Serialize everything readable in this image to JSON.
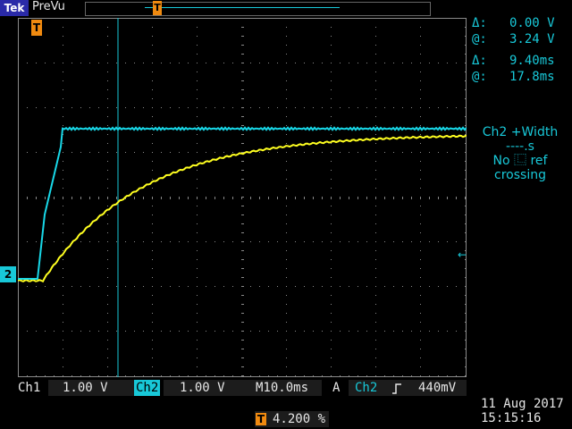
{
  "top": {
    "logo": "Tek",
    "acq_state": "PreVu",
    "trigger_marker": "T"
  },
  "screen": {
    "grid": true,
    "ch2_label": "2",
    "trigger_level_marker": "←"
  },
  "cursors": {
    "v_delta_sym": "Δ:",
    "v_delta": "0.00 V",
    "v_at_sym": "@:",
    "v_at": "3.24 V",
    "t_delta_sym": "Δ:",
    "t_delta": "9.40ms",
    "t_at_sym": "@:",
    "t_at": "17.8ms"
  },
  "measurement": {
    "line1": "Ch2 +Width",
    "line2": "----.s",
    "line3": "No ⿺ ref",
    "line4": "crossing"
  },
  "bottom": {
    "ch1_label": "Ch1",
    "ch1_scale": "1.00 V",
    "ch2_label": "Ch2",
    "ch2_scale": "1.00 V",
    "timebase": "M10.0ms",
    "trig_a": "A",
    "trig_source": "Ch2",
    "trig_slope_icon": "rising-edge-icon",
    "trig_level": "440mV",
    "trig_position": "4.200 %",
    "date": "11 Aug 2017",
    "time": "15:15:16"
  },
  "colors": {
    "ch1": "#ffff20",
    "ch2": "#18d8e8",
    "grid": "#808080"
  }
}
